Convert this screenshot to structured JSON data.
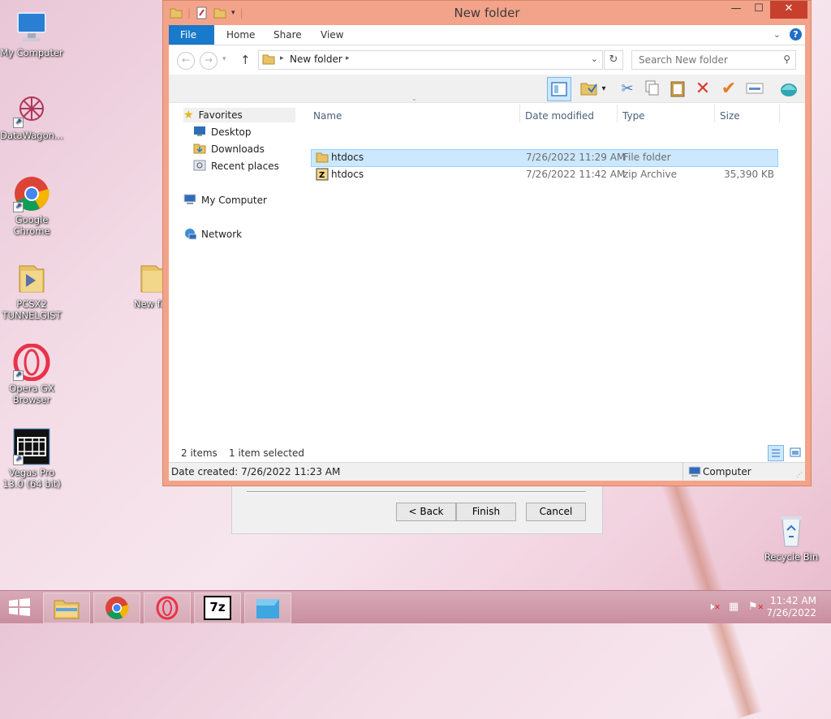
{
  "desktop": {
    "icons": [
      {
        "label": "My Computer"
      },
      {
        "label": "DataWagon..."
      },
      {
        "label": "Google Chrome"
      },
      {
        "label": "PCSX2 TUNNELGIST"
      },
      {
        "label": "New fo"
      },
      {
        "label": "Opera GX Browser"
      },
      {
        "label": "Vegas Pro 13.0 (64 bit)"
      },
      {
        "label": "Recycle Bin"
      }
    ]
  },
  "wizard": {
    "back": "< Back",
    "finish": "Finish",
    "cancel": "Cancel"
  },
  "window": {
    "title": "New folder",
    "minimize": "—",
    "maximize": "☐",
    "close": "✕",
    "ribbon_tabs": [
      "File",
      "Home",
      "Share",
      "View"
    ],
    "address": {
      "path": "New folder"
    },
    "search": {
      "placeholder": "Search New folder"
    },
    "nav": {
      "favorites": "Favorites",
      "desktop": "Desktop",
      "downloads": "Downloads",
      "recent": "Recent places",
      "computer": "My Computer",
      "network": "Network"
    },
    "columns": {
      "name": "Name",
      "date": "Date modified",
      "type": "Type",
      "size": "Size"
    },
    "files": [
      {
        "name": "htdocs",
        "date": "7/26/2022 11:29 AM",
        "type": "File folder",
        "size": ""
      },
      {
        "name": "htdocs",
        "date": "7/26/2022 11:42 AM",
        "type": "zip Archive",
        "size": "35,390 KB"
      }
    ],
    "status": {
      "count": "2 items",
      "selected": "1 item selected"
    },
    "details": {
      "created": "Date created: 7/26/2022 11:23 AM",
      "location": "Computer"
    }
  },
  "taskbar": {
    "time": "11:42 AM",
    "date": "7/26/2022",
    "zip_label": "7z"
  },
  "colors": {
    "accent": "#1979ca",
    "window_frame": "#f3a38a",
    "close": "#c7402e",
    "selection": "#cce8ff"
  }
}
